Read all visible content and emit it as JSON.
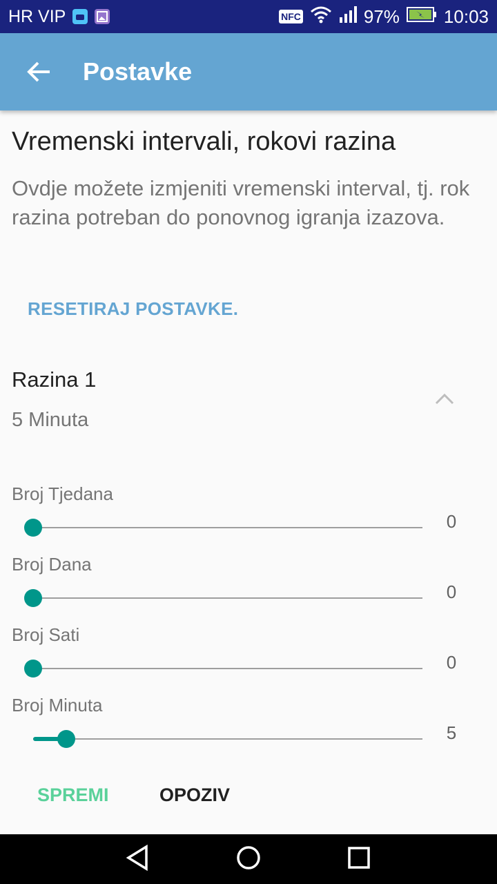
{
  "status_bar": {
    "carrier": "HR VIP",
    "nfc": "NFC",
    "battery": "97%",
    "time": "10:03"
  },
  "app_bar": {
    "title": "Postavke",
    "back_icon": "arrow-back-icon"
  },
  "content": {
    "heading": "Vremenski intervali, rokovi razina",
    "description": "Ovdje možete izmjeniti vremenski interval, tj. rok razina potreban do ponovnog igranja izazova.",
    "reset_label": "RESETIRAJ POSTAVKE."
  },
  "level": {
    "title": "Razina 1",
    "summary": "5 Minuta",
    "expanded": true
  },
  "sliders": [
    {
      "label": "Broj Tjedana",
      "value": "0",
      "fraction": 0
    },
    {
      "label": "Broj Dana",
      "value": "0",
      "fraction": 0
    },
    {
      "label": "Broj Sati",
      "value": "0",
      "fraction": 0
    },
    {
      "label": "Broj Minuta",
      "value": "5",
      "fraction": 0.085
    }
  ],
  "actions": {
    "save_label": "SPREMI",
    "cancel_label": "OPOZIV"
  },
  "colors": {
    "status_bar": "#1a237e",
    "app_bar": "#64a5d2",
    "accent": "#00968a",
    "save": "#5ad19a"
  }
}
